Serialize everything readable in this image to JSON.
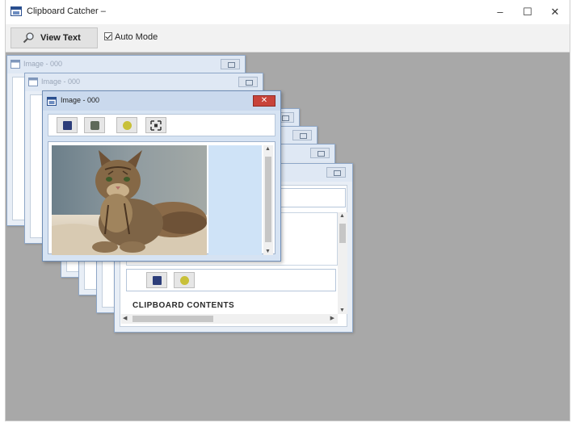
{
  "window": {
    "title": "Clipboard Catcher",
    "title_suffix": " –",
    "minimize_glyph": "–",
    "maximize_glyph": "☐",
    "close_glyph": "✕"
  },
  "toolbar": {
    "view_text_label": "View Text",
    "view_text_icon": "magnifier-icon",
    "auto_mode_label": "Auto Mode",
    "auto_mode_checked": true
  },
  "mdi_windows": {
    "back1_title": "Image - 000",
    "back2_title": "Image - 000",
    "front_title": "Image - 000",
    "front_close_glyph": "✕"
  },
  "text_window": {
    "content_label": "CLIPBOARD CONTENTS"
  },
  "colors": {
    "workspace": "#a8a8a8",
    "mdi_title": "#cad9ed",
    "close_red": "#c8433a"
  }
}
